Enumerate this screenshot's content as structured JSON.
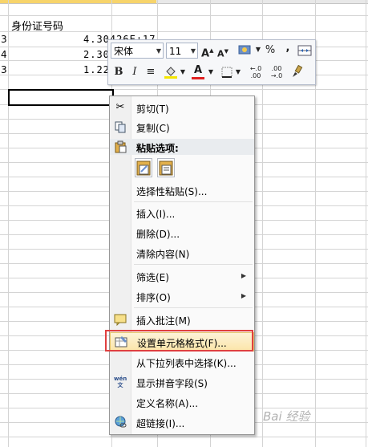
{
  "sheet": {
    "header": "身份证号码",
    "rows": [
      {
        "row_label": "3",
        "value": "4.30426E+17"
      },
      {
        "row_label": "4",
        "value": "2.30"
      },
      {
        "row_label": "3",
        "value": "1.22"
      }
    ]
  },
  "mini_toolbar": {
    "font_name": "宋体",
    "font_size": "11",
    "grow_font": "A",
    "shrink_font": "A",
    "percent": "%",
    "comma": ",",
    "bold": "B",
    "italic": "I",
    "align": "≡",
    "font_color": "A",
    "increase_decimal": "←.0 .00",
    "decrease_decimal": ".00 →.0"
  },
  "context_menu": {
    "items": [
      {
        "label": "剪切(T)",
        "icon": "scissors-icon"
      },
      {
        "label": "复制(C)",
        "icon": "copy-icon"
      },
      {
        "label": "粘贴选项:",
        "icon": "clipboard-icon"
      },
      {
        "label": "选择性粘贴(S)...",
        "icon": ""
      },
      {
        "label": "插入(I)...",
        "icon": ""
      },
      {
        "label": "删除(D)...",
        "icon": ""
      },
      {
        "label": "清除内容(N)",
        "icon": ""
      },
      {
        "label": "筛选(E)",
        "icon": "",
        "submenu": true
      },
      {
        "label": "排序(O)",
        "icon": "",
        "submenu": true
      },
      {
        "label": "插入批注(M)",
        "icon": "comment-icon"
      },
      {
        "label": "设置单元格格式(F)...",
        "icon": "format-cells-icon",
        "highlighted": true
      },
      {
        "label": "从下拉列表中选择(K)...",
        "icon": ""
      },
      {
        "label": "显示拼音字段(S)",
        "icon": "phonetic-icon"
      },
      {
        "label": "定义名称(A)...",
        "icon": ""
      },
      {
        "label": "超链接(I)...",
        "icon": "hyperlink-icon"
      }
    ],
    "phonetic_glyph": "wén 文"
  },
  "watermark": "Bai 经验"
}
